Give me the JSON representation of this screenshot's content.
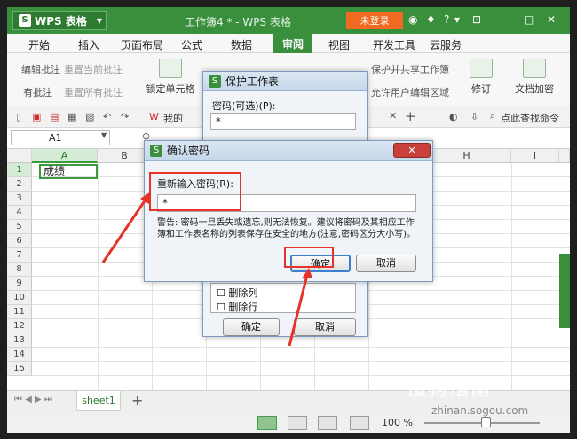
{
  "app": {
    "name": "WPS 表格",
    "window_title": "工作簿4 * - WPS 表格",
    "login_label": "未登录"
  },
  "menu": {
    "items": [
      "开始",
      "插入",
      "页面布局",
      "公式",
      "数据",
      "审阅",
      "视图",
      "开发工具",
      "云服务"
    ],
    "active": "审阅"
  },
  "ribbon": {
    "edit_comment": "编辑批注",
    "reset_current_comment": "重置当前批注",
    "has_comment": "有批注",
    "reset_all_comments": "重置所有批注",
    "lock_cell": "锁定单元格",
    "protect_share": "保护并共享工作簿",
    "allow_edit": "允许用户编辑区域",
    "revise": "修订",
    "doc_encrypt": "文档加密"
  },
  "toolbar": {
    "doc_tab": "我的",
    "search_label": "点此查找命令"
  },
  "formula_bar": {
    "cell_ref": "A1",
    "fx": "fx"
  },
  "grid": {
    "columns": [
      "A",
      "B",
      "C",
      "D",
      "E",
      "F",
      "G",
      "H",
      "I"
    ],
    "rows": [
      "1",
      "2",
      "3",
      "4",
      "5",
      "6",
      "7",
      "8",
      "9",
      "10",
      "11",
      "12",
      "13",
      "14",
      "15"
    ],
    "a1_value": "成绩"
  },
  "protect_dialog": {
    "title": "保护工作表",
    "password_label": "密码(可选)(P):",
    "password_value": "*",
    "options": [
      "删除列",
      "删除行"
    ],
    "ok": "确定",
    "cancel": "取消"
  },
  "confirm_dialog": {
    "title": "确认密码",
    "reenter_label": "重新输入密码(R):",
    "password_value": "*",
    "warning": "警告: 密码一旦丢失或遗忘,则无法恢复。建议将密码及其相应工作簿和工作表名称的列表保存在安全的地方(注意,密码区分大小写)。",
    "ok": "确定",
    "cancel": "取消"
  },
  "sheet_tab": "sheet1",
  "status": {
    "zoom": "100 %"
  },
  "watermark": {
    "text": "搜狗指南",
    "url": "zhinan.sogou.com"
  }
}
